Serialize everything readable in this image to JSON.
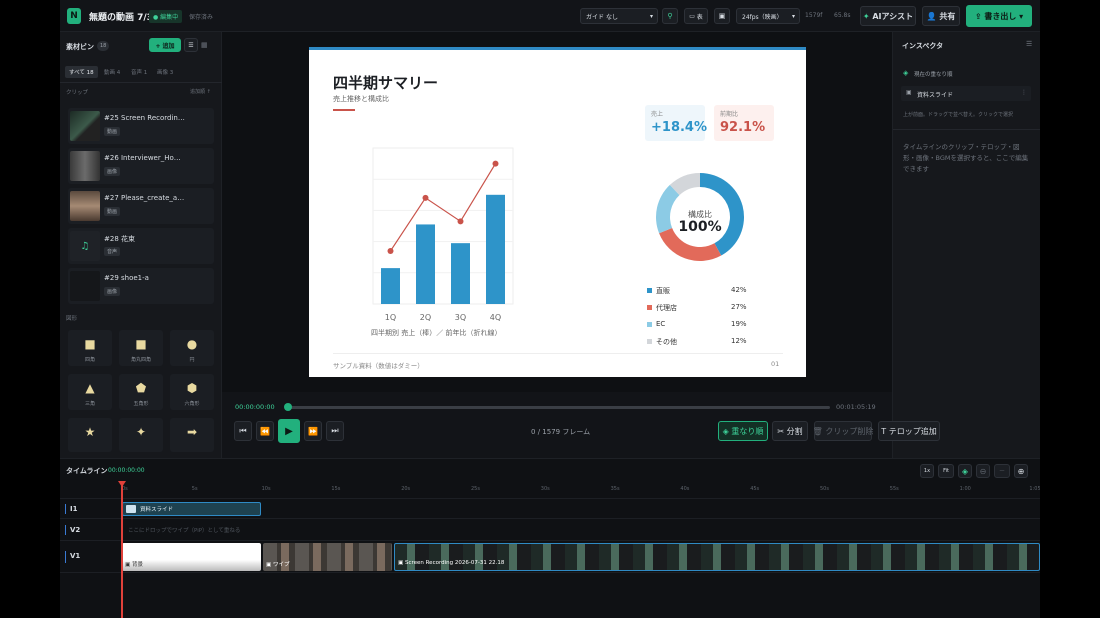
{
  "app": {
    "logo": "N",
    "title": "無題の動画 7/31",
    "status_badge": "● 編集中",
    "save_state": "保存済み"
  },
  "topbar": {
    "guide_label": "ガイド",
    "guide_value": "なし",
    "view_label": "表",
    "fps": "24fps（映画）",
    "frames": "1579f",
    "duration": "65.8s",
    "ai_label": "AIアシスト",
    "share_label": "共有",
    "export_label": "書き出し"
  },
  "bin": {
    "title": "素材ビン",
    "count": "18",
    "add_label": "+ 追加",
    "filters": [
      "すべて 18",
      "動画 4",
      "音声 1",
      "画像 3"
    ],
    "clips_label": "クリップ",
    "sort_label": "追加順 ↑",
    "clips": [
      {
        "title": "#25 Screen Recordin…",
        "tag": "動画"
      },
      {
        "title": "#26 Interviewer_Ho…",
        "tag": "画像"
      },
      {
        "title": "#27 Please_create_a…",
        "tag": "動画"
      },
      {
        "title": "#28 花束",
        "tag": "音声"
      },
      {
        "title": "#29 shoe1-a",
        "tag": "画像"
      }
    ],
    "shapes_label": "図形",
    "shapes": [
      {
        "glyph": "■",
        "label": "四角"
      },
      {
        "glyph": "■",
        "label": "角丸四角"
      },
      {
        "glyph": "●",
        "label": "円"
      },
      {
        "glyph": "▲",
        "label": "三角"
      },
      {
        "glyph": "⬟",
        "label": "五角形"
      },
      {
        "glyph": "⬢",
        "label": "六角形"
      },
      {
        "glyph": "★",
        "label": ""
      },
      {
        "glyph": "✦",
        "label": ""
      },
      {
        "glyph": "➡",
        "label": ""
      }
    ]
  },
  "slide": {
    "title": "四半期サマリー",
    "subtitle": "売上推移と構成比",
    "kpi1_label": "売上",
    "kpi1_value": "+18.4%",
    "kpi2_label": "前期比",
    "kpi2_value": "92.1%",
    "donut_label": "構成比",
    "donut_value": "100%",
    "chart_caption": "四半期別 売上（棒）／ 前年比（折れ線）",
    "footer_left": "サンプル資料（数値はダミー）",
    "footer_right": "01"
  },
  "chart_data": [
    {
      "type": "bar",
      "categories": [
        "1Q",
        "2Q",
        "3Q",
        "4Q"
      ],
      "series": [
        {
          "values": [
            23,
            51,
            39,
            70
          ],
          "color": "#2e94c9"
        },
        {
          "values": [
            34,
            68,
            53,
            90
          ],
          "color": "#c9534a",
          "type": "line"
        }
      ],
      "ylim": [
        0,
        100
      ],
      "xlabel": "四半期別 売上（棒）／ 前年比（折れ線）"
    },
    {
      "type": "pie",
      "categories": [
        "直販",
        "代理店",
        "EC",
        "その他"
      ],
      "values": [
        42,
        27,
        19,
        12
      ],
      "colors": [
        "#2e94c9",
        "#e26a5a",
        "#8ccbe5",
        "#d3d6da"
      ]
    }
  ],
  "inspector": {
    "title": "インスペクタ",
    "section": "現在の重なり順",
    "item": "資料スライド",
    "hint": "上が前面。ドラッグで並べ替え。クリックで選択",
    "desc": "タイムラインのクリップ・テロップ・図形・画像・BGMを選択すると、ここで編集できます"
  },
  "transport": {
    "current_time": "00:00:00:00",
    "end_time": "00:01:05:19",
    "frame": "0",
    "total_frames": "1579",
    "frames_label": "フレーム",
    "stack_label": "重なり順",
    "split_label": "分割",
    "delete_label": "クリップ削除",
    "caption_label": "テロップ追加",
    "progress": 0
  },
  "timeline": {
    "title": "タイムライン",
    "time": "00:00:00:00",
    "zoom_fit": "Fit",
    "zoom_1x": "1x",
    "ticks": [
      "0s",
      "5s",
      "10s",
      "15s",
      "20s",
      "25s",
      "30s",
      "35s",
      "40s",
      "45s",
      "50s",
      "55s",
      "1:00",
      "1:05"
    ],
    "tracks": [
      {
        "name": "I1",
        "clip": "資料スライド"
      },
      {
        "name": "V2",
        "hint": "ここにドロップでワイプ（PiP）として重ねる"
      },
      {
        "name": "V1",
        "clips": [
          "背景",
          "ワイプ",
          "Screen Recording 2026-07-31 22.18"
        ]
      }
    ]
  },
  "colors": {
    "accent": "#22b07d",
    "playhead": "#e0413a",
    "panel": "#16181c"
  }
}
